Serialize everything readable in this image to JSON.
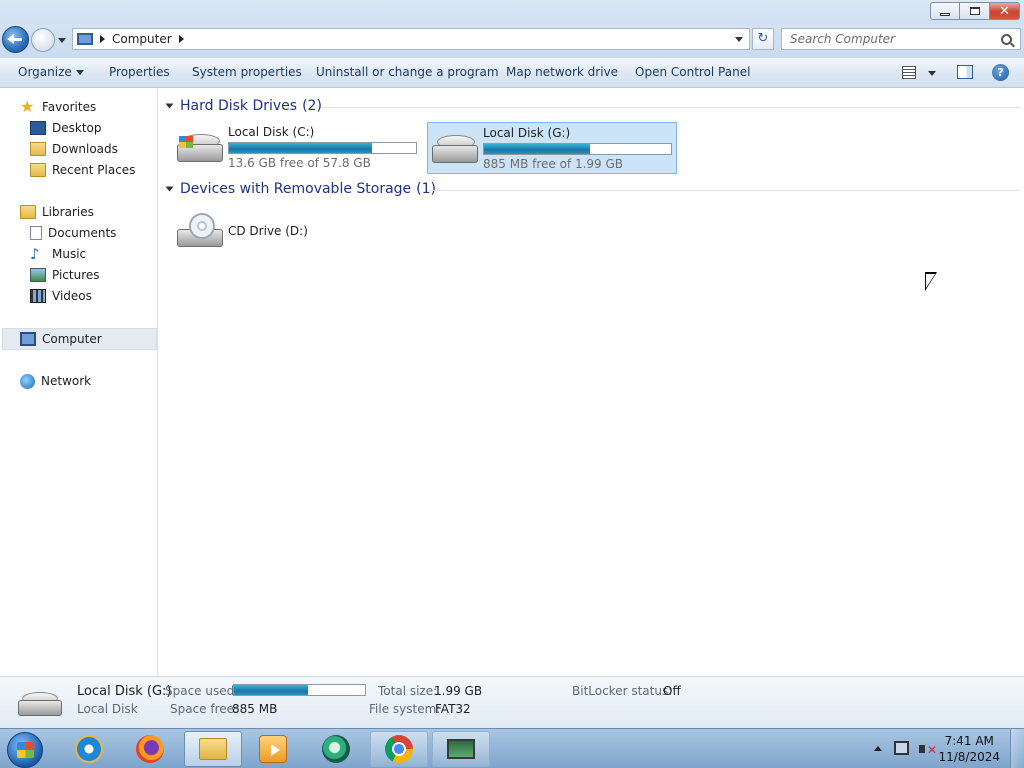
{
  "window": {
    "minimize_icon": "minimize-icon",
    "maximize_icon": "restore-icon",
    "close_icon": "close-icon"
  },
  "address": {
    "crumbs": [
      "Computer"
    ],
    "search_placeholder": "Search Computer"
  },
  "toolbar": {
    "organize": "Organize",
    "properties": "Properties",
    "system_properties": "System properties",
    "uninstall": "Uninstall or change a program",
    "map_drive": "Map network drive",
    "control_panel": "Open Control Panel"
  },
  "sidebar": {
    "favorites": {
      "label": "Favorites",
      "items": [
        {
          "label": "Desktop",
          "icon": "desktop-icon"
        },
        {
          "label": "Downloads",
          "icon": "downloads-folder-icon"
        },
        {
          "label": "Recent Places",
          "icon": "recent-places-icon"
        }
      ]
    },
    "libraries": {
      "label": "Libraries",
      "items": [
        {
          "label": "Documents",
          "icon": "documents-icon"
        },
        {
          "label": "Music",
          "icon": "music-icon"
        },
        {
          "label": "Pictures",
          "icon": "pictures-icon"
        },
        {
          "label": "Videos",
          "icon": "videos-icon"
        }
      ]
    },
    "computer": "Computer",
    "network": "Network"
  },
  "content": {
    "groups": [
      {
        "title": "Hard Disk Drives",
        "count": "(2)",
        "drives": [
          {
            "name": "Local Disk (C:)",
            "free_text": "13.6 GB free of 57.8 GB",
            "used_fraction": 0.765,
            "selected": false
          },
          {
            "name": "Local Disk (G:)",
            "free_text": "885 MB free of 1.99 GB",
            "used_fraction": 0.566,
            "selected": true
          }
        ]
      },
      {
        "title": "Devices with Removable Storage",
        "count": "(1)",
        "drives": [
          {
            "name": "CD Drive (D:)"
          }
        ]
      }
    ]
  },
  "details": {
    "name": "Local Disk (G:)",
    "type": "Local Disk",
    "space_used_label": "Space used:",
    "space_used_fraction": 0.566,
    "space_free_label": "Space free:",
    "space_free": "885 MB",
    "total_size_label": "Total size:",
    "total_size": "1.99 GB",
    "file_system_label": "File system:",
    "file_system": "FAT32",
    "bitlocker_label": "BitLocker status:",
    "bitlocker": "Off"
  },
  "taskbar": {
    "apps": [
      {
        "name": "internet-explorer-icon",
        "state": "idle"
      },
      {
        "name": "firefox-icon",
        "state": "idle"
      },
      {
        "name": "windows-explorer-icon",
        "state": "active"
      },
      {
        "name": "media-player-icon",
        "state": "idle"
      },
      {
        "name": "green-app-icon",
        "state": "idle"
      },
      {
        "name": "chrome-icon",
        "state": "open"
      },
      {
        "name": "system-monitor-icon",
        "state": "open"
      }
    ],
    "time": "7:41 AM",
    "date": "11/8/2024"
  }
}
